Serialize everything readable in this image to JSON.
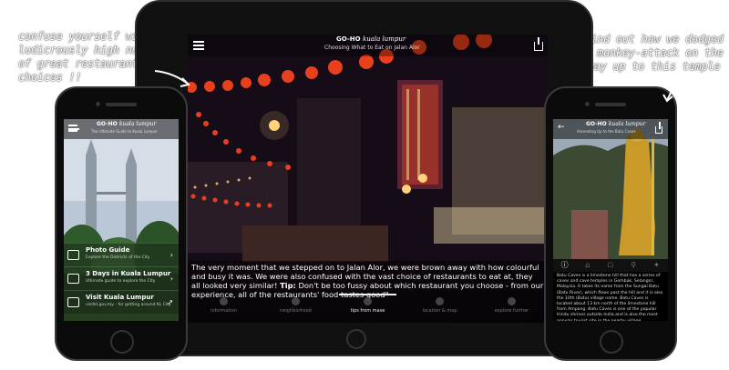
{
  "annotations": {
    "left": "confuse yourself with a ludicrously high number of great restaurant choices !!",
    "right": "find out how we dodged a monkey-attack on the way up to this temple"
  },
  "app": {
    "logo": "GO-HO",
    "city": "kuala lumpur"
  },
  "tablet": {
    "subtitle": "Choosing What to Eat on Jalan Alor",
    "body_start": "The very moment that we stepped on to Jalan Alor, we were brown away with how colourful and busy it was. We were also confused with the vast choice of restaurants to eat at, they all looked very similar!",
    "tip_label": "Tip:",
    "body_end": "Don't be too fussy about which restaurant you choose - from our experience, all of the restaurants' food tastes good\"",
    "tabs": [
      {
        "label": "information",
        "active": false
      },
      {
        "label": "neighborhood",
        "active": false
      },
      {
        "label": "tips from mase",
        "active": true
      },
      {
        "label": "location & map",
        "active": false
      },
      {
        "label": "explore further",
        "active": false
      }
    ]
  },
  "phone_left": {
    "subtitle": "The Ultimate Guide to Kuala Lumpur",
    "items": [
      {
        "title": "Photo Guide",
        "subtitle": "Explore the Districts of the City"
      },
      {
        "title": "3 Days in Kuala Lumpur",
        "subtitle": "Ultimate guide to explore the City"
      },
      {
        "title": "Visit Kuala Lumpur",
        "subtitle": "visitkl.gov.my - for getting around KL City"
      }
    ]
  },
  "phone_right": {
    "subtitle": "Ascending Up to the Batu Caves",
    "description": "Batu Caves is a limestone hill that has a series of caves and cave temples in Gombak, Selangor, Malaysia. It takes its name from the Sungai Batu (Batu River), which flows past the hill and it is also the 10th (Batu) village name. Batu Caves is located about 13 km north of the limestone hill from Ampang. Batu Caves is one of the popular Hindu shrines outside India and is also the most popular tourist site in the nearby village."
  },
  "colors": {
    "lantern": "#e8401c",
    "light": "#ffcc66",
    "dark": "#0c0812"
  }
}
